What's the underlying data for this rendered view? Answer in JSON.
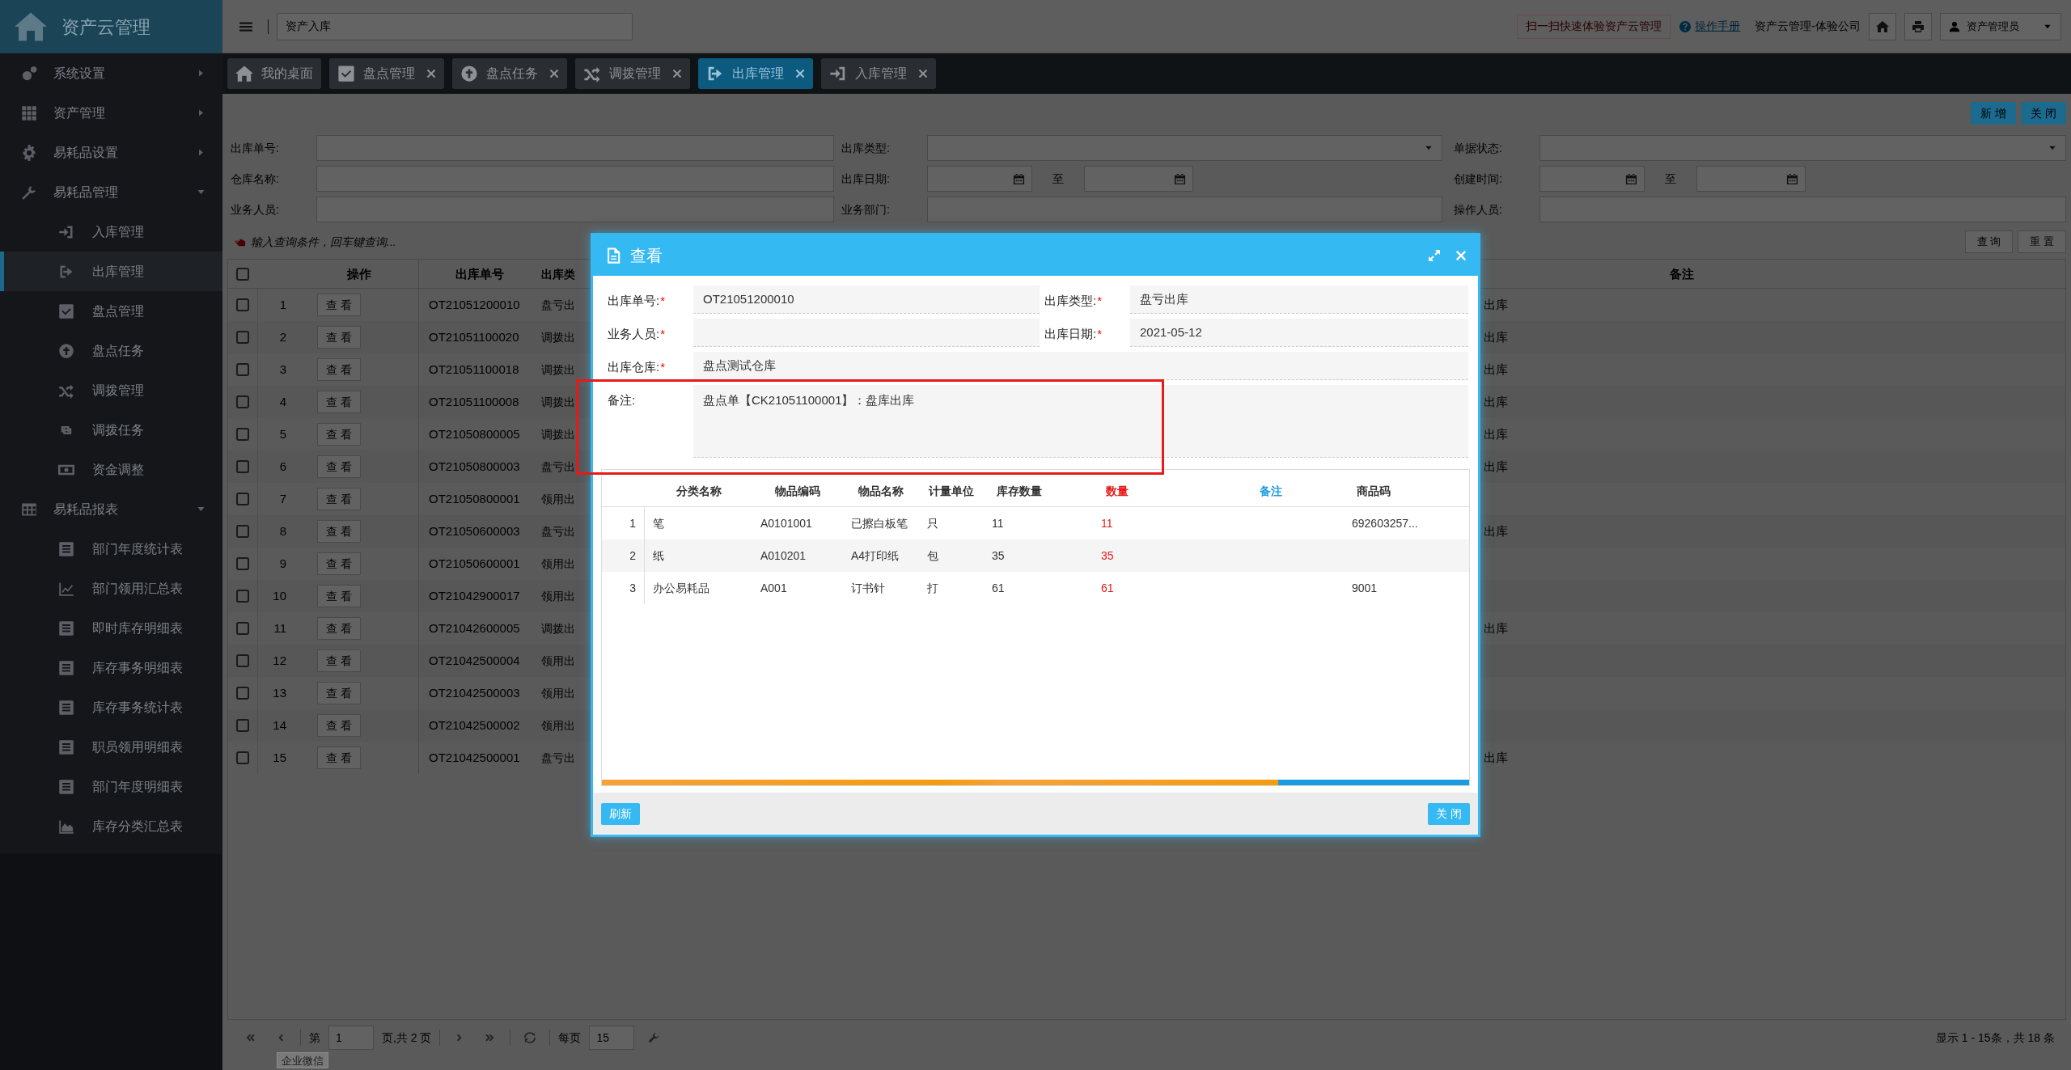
{
  "app": {
    "title": "资产云管理"
  },
  "sidebar": {
    "items": [
      {
        "label": "系统设置",
        "expanded": false,
        "selected": false
      },
      {
        "label": "资产管理",
        "expanded": false,
        "selected": false
      },
      {
        "label": "易耗品设置",
        "expanded": false,
        "selected": false
      },
      {
        "label": "易耗品管理",
        "expanded": true,
        "selected": false,
        "children": [
          {
            "label": "入库管理",
            "selected": false
          },
          {
            "label": "出库管理",
            "selected": true
          },
          {
            "label": "盘点管理",
            "selected": false
          },
          {
            "label": "盘点任务",
            "selected": false
          },
          {
            "label": "调拨管理",
            "selected": false
          },
          {
            "label": "调拨任务",
            "selected": false
          },
          {
            "label": "资金调整",
            "selected": false
          }
        ]
      },
      {
        "label": "易耗品报表",
        "expanded": true,
        "selected": false,
        "children": [
          {
            "label": "部门年度统计表",
            "selected": false
          },
          {
            "label": "部门领用汇总表",
            "selected": false
          },
          {
            "label": "即时库存明细表",
            "selected": false
          },
          {
            "label": "库存事务明细表",
            "selected": false
          },
          {
            "label": "库存事务统计表",
            "selected": false
          },
          {
            "label": "职员领用明细表",
            "selected": false
          },
          {
            "label": "部门年度明细表",
            "selected": false
          },
          {
            "label": "库存分类汇总表",
            "selected": false
          }
        ]
      }
    ]
  },
  "topbar": {
    "search_value": "资产入库",
    "promo": "扫一扫快速体验资产云管理",
    "manual_link": "操作手册",
    "company": "资产云管理-体验公司",
    "user": "资产管理员"
  },
  "tabs": [
    {
      "label": "我的桌面",
      "closable": false,
      "selected": false
    },
    {
      "label": "盘点管理",
      "closable": true,
      "selected": false
    },
    {
      "label": "盘点任务",
      "closable": true,
      "selected": false
    },
    {
      "label": "调拨管理",
      "closable": true,
      "selected": false
    },
    {
      "label": "出库管理",
      "closable": true,
      "selected": true
    },
    {
      "label": "入库管理",
      "closable": true,
      "selected": false
    }
  ],
  "toolbar": {
    "buttons": [
      "新 增",
      "关 闭"
    ]
  },
  "filters": [
    [
      {
        "label": "出库单号:",
        "kind": "text"
      },
      {
        "label": "出库类型:",
        "kind": "select"
      },
      {
        "label": "单据状态:",
        "kind": "select"
      }
    ],
    [
      {
        "label": "仓库名称:",
        "kind": "text"
      },
      {
        "label": "出库日期:",
        "kind": "daterange",
        "separator": "至"
      },
      {
        "label": "创建时间:",
        "kind": "daterange",
        "separator": "至"
      }
    ],
    [
      {
        "label": "业务人员:",
        "kind": "text"
      },
      {
        "label": "业务部门:",
        "kind": "text"
      },
      {
        "label": "操作人员:",
        "kind": "text"
      }
    ]
  ],
  "hint": "输入查询条件，回车键查询...",
  "search_buttons": [
    "查 询",
    "重 置"
  ],
  "table": {
    "header_checked": false,
    "columns": {
      "action": "操作",
      "order_no": "出库单号",
      "type": "出库类",
      "remark": "备注"
    },
    "rows": [
      {
        "checked": false,
        "number": "1",
        "action": "查 看",
        "order_no": "OT21051200010",
        "type": "盘亏出",
        "column_5": "出库"
      },
      {
        "checked": false,
        "number": "2",
        "action": "查 看",
        "order_no": "OT21051100020",
        "type": "调拨出",
        "column_5": "出库"
      },
      {
        "checked": false,
        "number": "3",
        "action": "查 看",
        "order_no": "OT21051100018",
        "type": "调拨出",
        "column_5": "出库"
      },
      {
        "checked": false,
        "number": "4",
        "action": "查 看",
        "order_no": "OT21051100008",
        "type": "调拨出",
        "column_5": "出库"
      },
      {
        "checked": false,
        "number": "5",
        "action": "查 看",
        "order_no": "OT21050800005",
        "type": "调拨出",
        "column_5": "出库"
      },
      {
        "checked": false,
        "number": "6",
        "action": "查 看",
        "order_no": "OT21050800003",
        "type": "盘亏出",
        "column_5": "出库"
      },
      {
        "checked": false,
        "number": "7",
        "action": "查 看",
        "order_no": "OT21050800001",
        "type": "领用出"
      },
      {
        "checked": false,
        "number": "8",
        "action": "查 看",
        "order_no": "OT21050600003",
        "type": "盘亏出",
        "column_5": "出库"
      },
      {
        "checked": false,
        "number": "9",
        "action": "查 看",
        "order_no": "OT21050600001",
        "type": "领用出"
      },
      {
        "checked": false,
        "number": "10",
        "action": "查 看",
        "order_no": "OT21042900017",
        "type": "领用出"
      },
      {
        "checked": false,
        "number": "11",
        "action": "查 看",
        "order_no": "OT21042600005",
        "type": "调拨出",
        "column_5": "出库"
      },
      {
        "checked": false,
        "number": "12",
        "action": "查 看",
        "order_no": "OT21042500004",
        "type": "领用出"
      },
      {
        "checked": false,
        "number": "13",
        "action": "查 看",
        "order_no": "OT21042500003",
        "type": "领用出"
      },
      {
        "checked": false,
        "number": "14",
        "action": "查 看",
        "order_no": "OT21042500002",
        "type": "领用出"
      },
      {
        "checked": false,
        "number": "15",
        "action": "查 看",
        "order_no": "OT21042500001",
        "type": "盘亏出",
        "column_5": "出库"
      }
    ]
  },
  "pagination": {
    "page_label": "第",
    "page": "1",
    "page_total": "页,共 2 页",
    "per_page_label": "每页",
    "per_page": "15",
    "summary": "显示 1 - 15条，共 18 条"
  },
  "tooltip": "企业微信",
  "dialog": {
    "title": "查看",
    "fields": [
      {
        "label": "出库单号:",
        "required_mark": "*",
        "value": "OT21051200010",
        "kind": "half"
      },
      {
        "label": "出库类型:",
        "required_mark": "*",
        "value": "盘亏出库",
        "kind": "half"
      },
      {
        "label": "业务人员:",
        "required_mark": "*",
        "kind": "half"
      },
      {
        "label": "出库日期:",
        "required_mark": "*",
        "value": "2021-05-12",
        "kind": "half"
      },
      {
        "label": "出库仓库:",
        "required_mark": "*",
        "value": "盘点测试仓库",
        "kind": "full"
      },
      {
        "label": "备注:",
        "value": "盘点单【CK21051100001】：盘库出库",
        "kind": "memo"
      }
    ],
    "grid": {
      "columns": [
        {
          "label": "分类名称",
          "kind": "plain"
        },
        {
          "label": "物品编码",
          "kind": "plain"
        },
        {
          "label": "物品名称",
          "kind": "plain"
        },
        {
          "label": "计量单位",
          "kind": "plain"
        },
        {
          "label": "库存数量",
          "kind": "plain"
        },
        {
          "label": "数量",
          "kind": "required"
        },
        {
          "label": "备注",
          "kind": "optional"
        },
        {
          "label": "商品码",
          "kind": "plain"
        }
      ],
      "rows": [
        {
          "number": "1",
          "cells": [
            "笔",
            "A0101001",
            "已擦白板笔",
            "只",
            "11",
            "11",
            "",
            "692603257..."
          ]
        },
        {
          "number": "2",
          "cells": [
            "纸",
            "A010201",
            "A4打印纸",
            "包",
            "35",
            "35",
            "",
            ""
          ]
        },
        {
          "number": "3",
          "cells": [
            "办公易耗品",
            "A001",
            "订书针",
            "打",
            "61",
            "61",
            "",
            "9001"
          ]
        }
      ]
    },
    "buttons": [
      "刷新",
      "关 闭"
    ]
  }
}
